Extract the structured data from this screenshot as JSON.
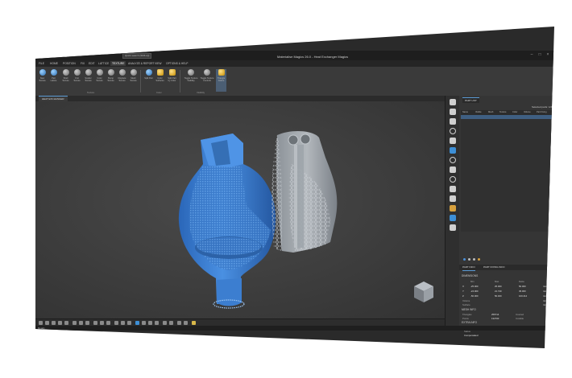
{
  "window": {
    "title": "Materialise Magics 26.0 - Heat Exchanger Magics",
    "search_placeholder": "Quick search (Shift+Q)"
  },
  "menu": {
    "tabs": [
      "FILE",
      "HOME",
      "POSITION",
      "FIX",
      "EDIT",
      "LATTICE",
      "TEXTURE",
      "ANALYZE & REPORT",
      "VIEW",
      "OPTIONS & HELP"
    ],
    "active": "TEXTURE"
  },
  "ribbon": {
    "buttons": [
      "New Texture",
      "Part Lattice",
      "Shell Texture",
      "Knit Texture",
      "Scatter Texture",
      "Color Texture",
      "Bump Texture",
      "Displace Texture",
      "Mesh Texture",
      "Split Part",
      "Color Surfaces",
      "Split Part by Color",
      "Toggle Texture Visibility",
      "Toggle Texture Controls",
      "Triangle Colors"
    ],
    "groups": [
      "Texture",
      "Color",
      "Visibility"
    ]
  },
  "doc_tab": "HEAT EXCHANGER",
  "status_text": "Ready",
  "right_panel": {
    "tab_part_list": "PART LIST",
    "selected_parts": "Selected parts: 1/2",
    "list_columns": [
      "Name",
      "Visible",
      "Mesh",
      "Texture",
      "Color",
      "Volume",
      "Part Fixing"
    ],
    "info_tab_part": "PART INFO",
    "info_tab_fixing": "PART FIXING INFO",
    "dimensions_title": "DIMENSIONS",
    "dim_headers": [
      "Min",
      "Max",
      "Delta"
    ],
    "dims": [
      {
        "axis": "X",
        "min": "-25.000",
        "max": "25.000",
        "delta": "50.000",
        "unit": "mm"
      },
      {
        "axis": "Y",
        "min": "-24.000",
        "max": "21.740",
        "delta": "45.000",
        "unit": "mm"
      },
      {
        "axis": "Z",
        "min": "-50.000",
        "max": "50.400",
        "delta": "100.214",
        "unit": "mm"
      }
    ],
    "volume_label": "Volume",
    "surface_label": "Surface",
    "volume_unit": "mm³",
    "surface_unit": "mm²",
    "mesh_title": "MESH INFO",
    "triangles_label": "Triangles",
    "triangles_value": "256714",
    "points_label": "Points",
    "points_value": "132700",
    "inverted_label": "Inverted",
    "invisible_label": "Invisible",
    "extra_title": "EXTRA INFO",
    "status_label": "Status",
    "status_value": "Compensated"
  },
  "colors": {
    "accent": "#5b9bd5",
    "model_blue": "#3d7fd0",
    "model_gray": "#9aa0a6"
  }
}
